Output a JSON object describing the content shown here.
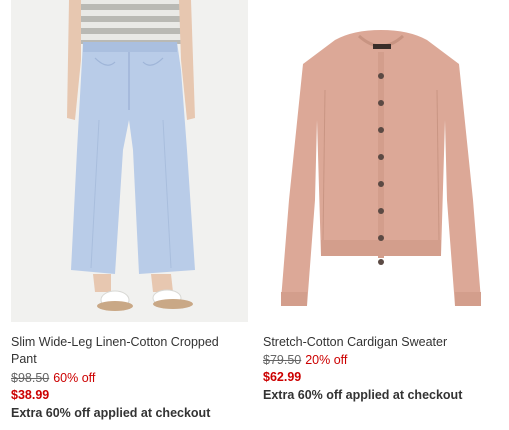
{
  "products": [
    {
      "image_alt": "Slim Wide-Leg Linen-Cotton Cropped Pant",
      "title": "Slim Wide-Leg Linen-Cotton Cropped Pant",
      "original_price": "$98.50",
      "discount": "60% off",
      "sale_price": "$38.99",
      "promo": "Extra 60% off applied at checkout"
    },
    {
      "image_alt": "Stretch-Cotton Cardigan Sweater",
      "title": "Stretch-Cotton Cardigan Sweater",
      "original_price": "$79.50",
      "discount": "20% off",
      "sale_price": "$62.99",
      "promo": "Extra 60% off applied at checkout"
    }
  ],
  "colors": {
    "sale_red": "#cc0000",
    "text": "#333333",
    "strike": "#666666",
    "pant_blue": "#b9cce8",
    "cardigan_pink": "#dca897"
  }
}
